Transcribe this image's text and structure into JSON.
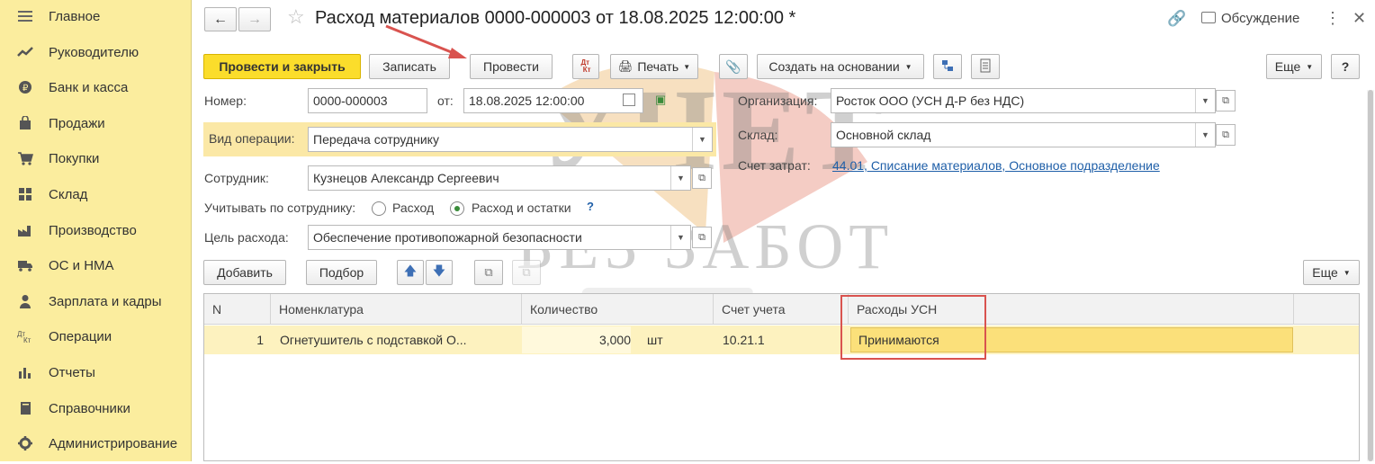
{
  "sidebar": {
    "items": [
      {
        "label": "Главное",
        "icon": "menu-icon"
      },
      {
        "label": "Руководителю",
        "icon": "trend-icon"
      },
      {
        "label": "Банк и касса",
        "icon": "coin-icon"
      },
      {
        "label": "Продажи",
        "icon": "bag-icon"
      },
      {
        "label": "Покупки",
        "icon": "cart-icon"
      },
      {
        "label": "Склад",
        "icon": "warehouse-icon"
      },
      {
        "label": "Производство",
        "icon": "factory-icon"
      },
      {
        "label": "ОС и НМА",
        "icon": "truck-icon"
      },
      {
        "label": "Зарплата и кадры",
        "icon": "person-icon"
      },
      {
        "label": "Операции",
        "icon": "dt-kt-icon"
      },
      {
        "label": "Отчеты",
        "icon": "bar-chart-icon"
      },
      {
        "label": "Справочники",
        "icon": "book-icon"
      },
      {
        "label": "Администрирование",
        "icon": "gear-icon"
      }
    ]
  },
  "header": {
    "title": "Расход материалов 0000-000003 от 18.08.2025 12:00:00 *",
    "discussion": "Обсуждение"
  },
  "toolbar": {
    "post_close": "Провести и закрыть",
    "save": "Записать",
    "post": "Провести",
    "dtkt": "Дт Кт",
    "print": "Печать",
    "create_based": "Создать на основании",
    "more": "Еще",
    "help": "?"
  },
  "form": {
    "number_label": "Номер:",
    "number_value": "0000-000003",
    "from_label": "от:",
    "date_value": "18.08.2025 12:00:00",
    "org_label": "Организация:",
    "org_value": "Росток ООО (УСН Д-Р без НДС)",
    "op_label": "Вид операции:",
    "op_value": "Передача сотруднику",
    "stock_label": "Склад:",
    "stock_value": "Основной склад",
    "cost_label": "Счет затрат:",
    "cost_link": "44.01, Списание материалов, Основное подразделение",
    "employee_label": "Сотрудник:",
    "employee_value": "Кузнецов Александр Сергеевич",
    "account_by_label": "Учитывать по сотруднику:",
    "radio_expense": "Расход",
    "radio_expense_balance": "Расход и остатки",
    "radio_selected": "Расход и остатки",
    "hint": "?",
    "purpose_label": "Цель расхода:",
    "purpose_value": "Обеспечение противопожарной безопасности"
  },
  "table_toolbar": {
    "add": "Добавить",
    "pick": "Подбор",
    "more": "Еще"
  },
  "table": {
    "columns": [
      "N",
      "Номенклатура",
      "Количество",
      "Счет учета",
      "Расходы УСН"
    ],
    "rows": [
      {
        "n": "1",
        "item": "Огнетушитель с подставкой О...",
        "qty": "3,000",
        "unit": "шт",
        "account": "10.21.1",
        "usn": "Принимаются"
      }
    ]
  },
  "watermark": {
    "line1": "УЧЕТ",
    "line2": "БЕЗ ЗАБОТ"
  },
  "colors": {
    "sidebar_bg": "#fbed9e",
    "primary_button": "#fbdd2b",
    "selected_row": "#fdf2bf",
    "highlight_box": "#d9534f",
    "link": "#1f5fa8"
  }
}
